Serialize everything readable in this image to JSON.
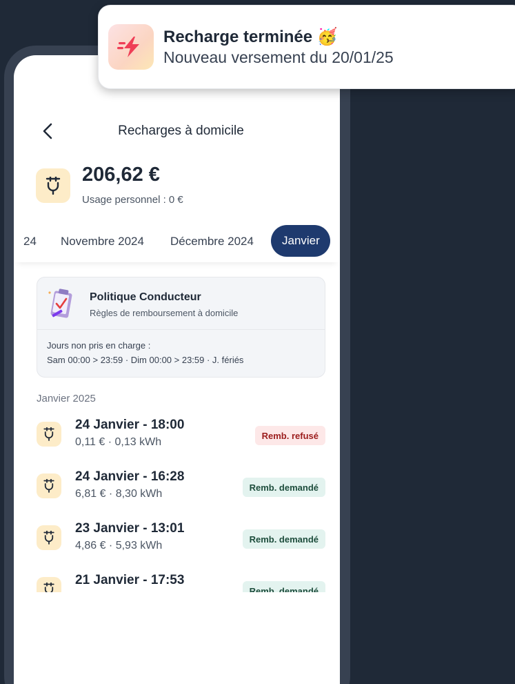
{
  "notification": {
    "title": "Recharge terminée 🥳",
    "subtitle": "Nouveau versement du 20/01/25"
  },
  "header": {
    "title": "Recharges à domicile"
  },
  "summary": {
    "amount": "206,62 €",
    "personal_usage": "Usage personnel : 0 €"
  },
  "tabs": [
    {
      "label": "24"
    },
    {
      "label": "Novembre 2024"
    },
    {
      "label": "Décembre 2024"
    },
    {
      "label": "Janvier",
      "active": true
    }
  ],
  "policy": {
    "title": "Politique Conducteur",
    "subtitle": "Règles de remboursement à domicile",
    "days_label": "Jours non pris en charge :",
    "days": "Sam 00:00 > 23:59 · Dim 00:00 > 23:59 · J. fériés"
  },
  "section": {
    "label": "Janvier 2025"
  },
  "items": [
    {
      "title": "24 Janvier - 18:00",
      "details": "0,11 € · 0,13 kWh",
      "badge": "Remb. refusé",
      "status": "refused"
    },
    {
      "title": "24 Janvier - 16:28",
      "details": "6,81 € · 8,30 kWh",
      "badge": "Remb. demandé",
      "status": "requested"
    },
    {
      "title": "23 Janvier - 13:01",
      "details": "4,86 € · 5,93 kWh",
      "badge": "Remb. demandé",
      "status": "requested"
    },
    {
      "title": "21 Janvier - 17:53",
      "details": "",
      "badge": "Remb. demandé",
      "status": "requested"
    }
  ],
  "colors": {
    "background": "#1f2937",
    "accent": "#1e3a6e",
    "icon_bg": "#fdecc8",
    "refused_bg": "#fde8e8",
    "requested_bg": "#e3f3ef"
  }
}
